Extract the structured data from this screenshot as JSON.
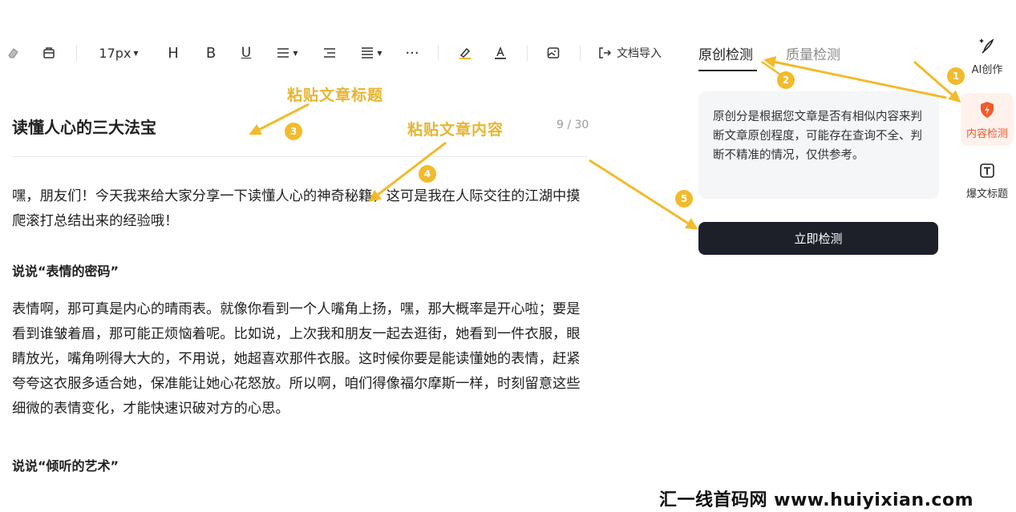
{
  "toolbar": {
    "font_size": "17px",
    "heading": "H",
    "bold": "B",
    "underline": "U",
    "import_label": "文档导入"
  },
  "tabs": [
    {
      "label": "原创检测",
      "active": true
    },
    {
      "label": "质量检测",
      "active": false
    }
  ],
  "article": {
    "title": "读懂人心的三大法宝",
    "counter": "9 / 30",
    "para1": "嘿，朋友们！今天我来给大家分享一下读懂人心的神奇秘籍，这可是我在人际交往的江湖中摸爬滚打总结出来的经验哦！",
    "subhead1": "说说“表情的密码”",
    "para2": "表情啊，那可真是内心的晴雨表。就像你看到一个人嘴角上扬，嘿，那大概率是开心啦；要是看到谁皱着眉，那可能正烦恼着呢。比如说，上次我和朋友一起去逛街，她看到一件衣服，眼睛放光，嘴角咧得大大的，不用说，她超喜欢那件衣服。这时候你要是能读懂她的表情，赶紧夸夸这衣服多适合她，保准能让她心花怒放。所以啊，咱们得像福尔摩斯一样，时刻留意这些细微的表情变化，才能快速识破对方的心思。",
    "subhead2": "说说“倾听的艺术”"
  },
  "panel": {
    "info": "原创分是根据您文章是否有相似内容来判断文章原创程度，可能存在查询不全、判断不精准的情况，仅供参考。",
    "button": "立即检测"
  },
  "rail": [
    {
      "label": "AI创作",
      "icon": "pen-sparkle-icon"
    },
    {
      "label": "内容检测",
      "icon": "shield-check-icon",
      "active": true
    },
    {
      "label": "爆文标题",
      "icon": "title-t-icon"
    }
  ],
  "annotations": {
    "paste_title": "粘贴文章标题",
    "paste_content": "粘贴文章内容",
    "badges": [
      "1",
      "2",
      "3",
      "4",
      "5"
    ]
  },
  "watermark": "汇一线首码网 www.huiyixian.com",
  "colors": {
    "annotation": "#F2BB2C",
    "button_bg": "#1E2029",
    "active_rail": "#F05A2B"
  }
}
